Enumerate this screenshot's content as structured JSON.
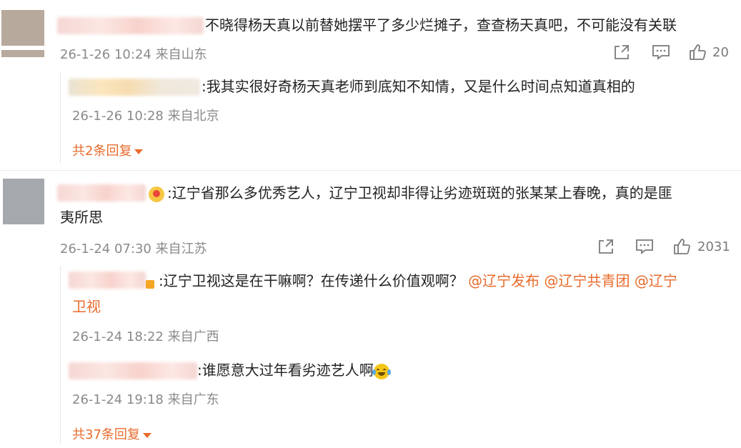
{
  "comments": [
    {
      "text": "不晓得杨天真以前替她摆平了多少烂摊子，查查杨天真吧，不可能没有关联",
      "time": "26-1-26 10:24",
      "location": "来自山东",
      "likes": "20",
      "replies": [
        {
          "text": ":我其实很好奇杨天真老师到底知不知情，又是什么时间点知道真相的",
          "time": "26-1-26 10:28",
          "location": "来自北京"
        }
      ],
      "more": "共2条回复"
    },
    {
      "text_line1": ":辽宁省那么多优秀艺人，辽宁卫视却非得让劣迹斑斑的张某某上春晚，真的是匪",
      "text_line2": "夷所思",
      "time": "26-1-24 07:30",
      "location": "来自江苏",
      "likes": "2031",
      "replies": [
        {
          "text": ":辽宁卫视这是在干嘛啊？在传递什么价值观啊？",
          "mention1": "@辽宁发布",
          "mention2": "@辽宁共青团",
          "mention3_line1": "@辽宁",
          "mention3_line2": "卫视",
          "time": "26-1-24 18:22",
          "location": "来自广西"
        },
        {
          "text": ":谁愿意大过年看劣迹艺人啊",
          "time": "26-1-24 19:18",
          "location": "来自广东"
        }
      ],
      "more": "共37条回复"
    }
  ],
  "icons": {
    "share": "share-icon",
    "comment": "comment-icon",
    "like": "thumbs-up-icon",
    "laugh_cry": "laugh-cry-emoji-icon",
    "vip": "vip-badge-icon"
  },
  "colors": {
    "link": "#e86b2c",
    "meta": "#8a8a8a",
    "text": "#222222"
  }
}
